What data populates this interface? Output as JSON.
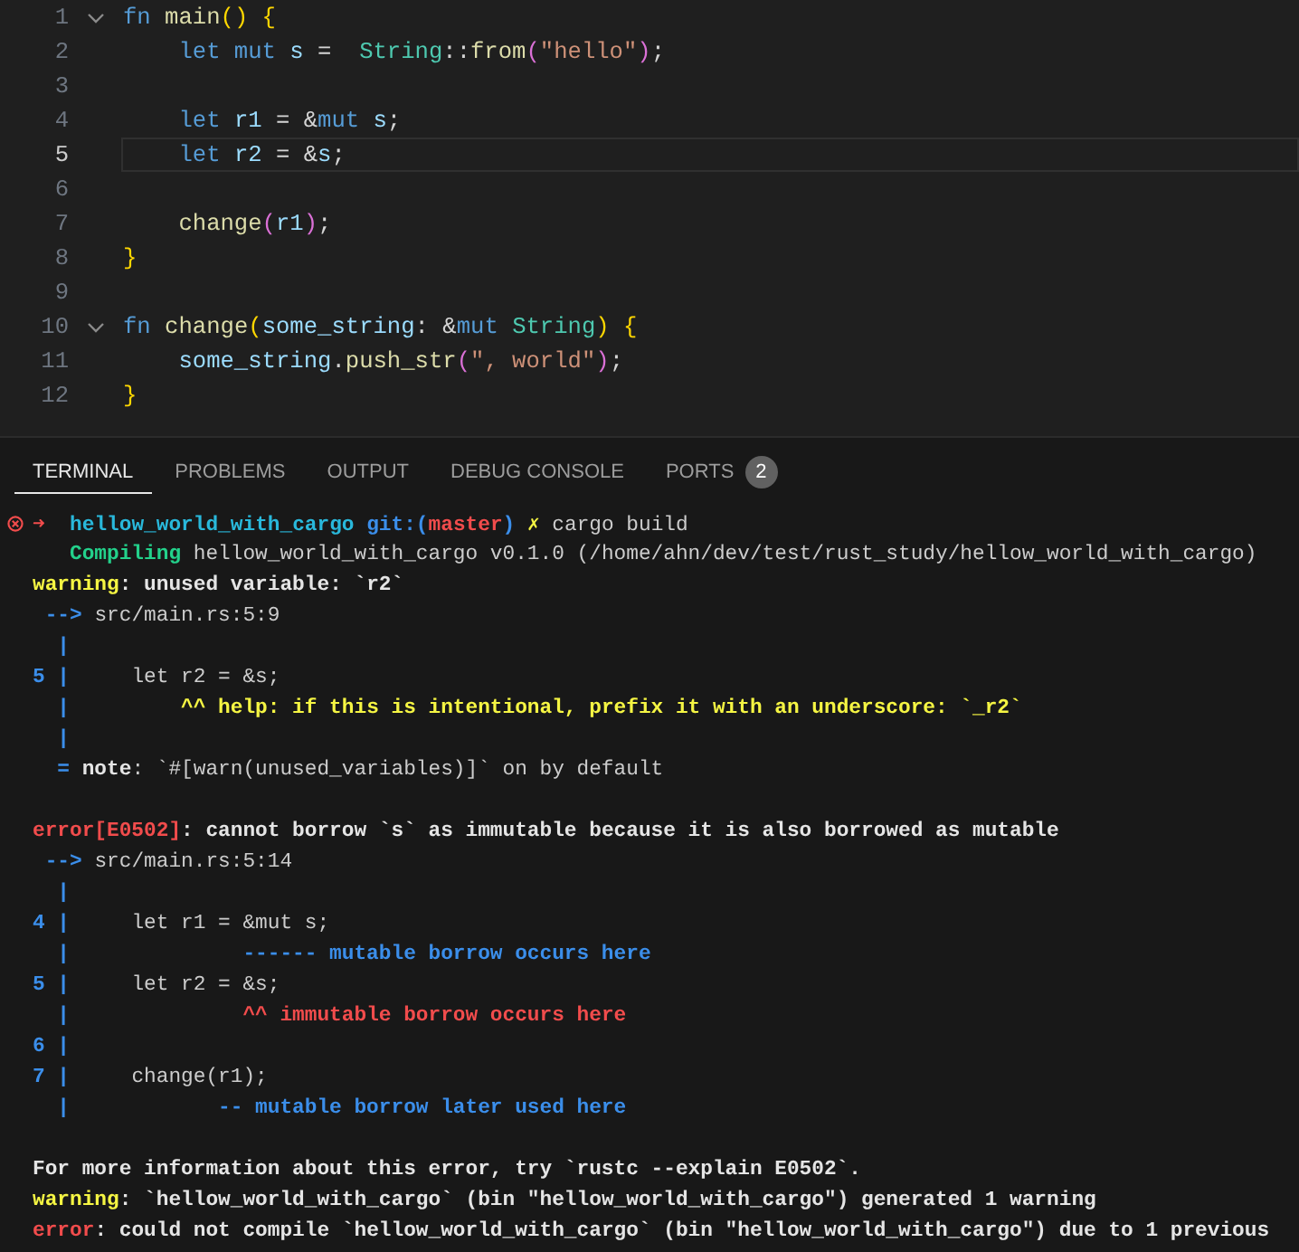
{
  "editor": {
    "lines": [
      {
        "number": "1",
        "current": false,
        "expanded": true,
        "segments": [
          {
            "kind": "kw",
            "text": "fn "
          },
          {
            "kind": "fn",
            "text": "main"
          },
          {
            "kind": "b1",
            "text": "() {"
          }
        ]
      },
      {
        "number": "2",
        "current": false,
        "segments": [
          {
            "kind": "kw",
            "text": "    let mut "
          },
          {
            "kind": "var",
            "text": "s"
          },
          {
            "kind": "plain",
            "text": " =  "
          },
          {
            "kind": "type",
            "text": "String"
          },
          {
            "kind": "plain",
            "text": "::"
          },
          {
            "kind": "fn",
            "text": "from"
          },
          {
            "kind": "b2",
            "text": "("
          },
          {
            "kind": "str",
            "text": "\"hello\""
          },
          {
            "kind": "b2",
            "text": ")"
          },
          {
            "kind": "plain",
            "text": ";"
          }
        ]
      },
      {
        "number": "3",
        "current": false
      },
      {
        "number": "4",
        "current": false,
        "segments": [
          {
            "kind": "kw",
            "text": "    let "
          },
          {
            "kind": "var",
            "text": "r1"
          },
          {
            "kind": "plain",
            "text": " = &"
          },
          {
            "kind": "kw",
            "text": "mut "
          },
          {
            "kind": "var",
            "text": "s"
          },
          {
            "kind": "plain",
            "text": ";"
          }
        ]
      },
      {
        "number": "5",
        "current": true,
        "segments": [
          {
            "kind": "kw",
            "text": "    let "
          },
          {
            "kind": "var",
            "text": "r2"
          },
          {
            "kind": "plain",
            "text": " = &"
          },
          {
            "kind": "var",
            "text": "s"
          },
          {
            "kind": "plain",
            "text": ";"
          }
        ]
      },
      {
        "number": "6",
        "current": false
      },
      {
        "number": "7",
        "current": false,
        "segments": [
          {
            "kind": "fn",
            "text": "    change"
          },
          {
            "kind": "b2",
            "text": "("
          },
          {
            "kind": "var",
            "text": "r1"
          },
          {
            "kind": "b2",
            "text": ")"
          },
          {
            "kind": "plain",
            "text": ";"
          }
        ]
      },
      {
        "number": "8",
        "current": false,
        "segments": [
          {
            "kind": "b1",
            "text": "}"
          }
        ]
      },
      {
        "number": "9",
        "current": false
      },
      {
        "number": "10",
        "current": false,
        "expanded": true,
        "segments": [
          {
            "kind": "kw",
            "text": "fn "
          },
          {
            "kind": "fn",
            "text": "change"
          },
          {
            "kind": "b1",
            "text": "("
          },
          {
            "kind": "var",
            "text": "some_string"
          },
          {
            "kind": "plain",
            "text": ": &"
          },
          {
            "kind": "kw",
            "text": "mut "
          },
          {
            "kind": "type",
            "text": "String"
          },
          {
            "kind": "b1",
            "text": ") {"
          }
        ]
      },
      {
        "number": "11",
        "current": false,
        "segments": [
          {
            "kind": "var",
            "text": "    some_string"
          },
          {
            "kind": "plain",
            "text": "."
          },
          {
            "kind": "fn",
            "text": "push_str"
          },
          {
            "kind": "b2",
            "text": "("
          },
          {
            "kind": "str",
            "text": "\", world\""
          },
          {
            "kind": "b2",
            "text": ")"
          },
          {
            "kind": "plain",
            "text": ";"
          }
        ]
      },
      {
        "number": "12",
        "current": false,
        "segments": [
          {
            "kind": "b1",
            "text": "}"
          }
        ]
      }
    ]
  },
  "panel": {
    "tabs": [
      {
        "label": "TERMINAL",
        "selected": true
      },
      {
        "label": "PROBLEMS",
        "selected": false
      },
      {
        "label": "OUTPUT",
        "selected": false
      },
      {
        "label": "DEBUG CONSOLE",
        "selected": false
      },
      {
        "label": "PORTS",
        "selected": false,
        "badge": "2"
      }
    ]
  },
  "terminal": {
    "lines": [
      {
        "kind": "prompt",
        "failed": true,
        "segments": [
          {
            "kind": "err",
            "text": "➜  "
          },
          {
            "kind": "cyan",
            "text": "hellow_world_with_cargo "
          },
          {
            "kind": "blue",
            "text": "git:("
          },
          {
            "kind": "err",
            "text": "master"
          },
          {
            "kind": "blue",
            "text": ") "
          },
          {
            "kind": "warn",
            "text": "✗"
          },
          {
            "kind": "plain",
            "text": " cargo build"
          }
        ]
      },
      {
        "kind": "output",
        "segments": [
          {
            "kind": "green",
            "text": "   Compiling"
          },
          {
            "kind": "plain",
            "text": " hellow_world_with_cargo v0.1.0 (/home/ahn/dev/test/rust_study/hellow_world_with_cargo)"
          }
        ]
      },
      {
        "kind": "output",
        "segments": [
          {
            "kind": "warn",
            "text": "warning"
          },
          {
            "kind": "bold",
            "text": ": unused variable: `r2`"
          }
        ]
      },
      {
        "kind": "output",
        "segments": [
          {
            "kind": "blue",
            "text": " --> "
          },
          {
            "kind": "plain",
            "text": "src/main.rs:5:9"
          }
        ]
      },
      {
        "kind": "output",
        "segments": [
          {
            "kind": "blue",
            "text": "  |"
          }
        ]
      },
      {
        "kind": "output",
        "segments": [
          {
            "kind": "blue",
            "text": "5 |"
          },
          {
            "kind": "plain",
            "text": "     let r2 = &s;"
          }
        ]
      },
      {
        "kind": "output",
        "segments": [
          {
            "kind": "blue",
            "text": "  |"
          },
          {
            "kind": "warn",
            "text": "         ^^ help: if this is intentional, prefix it with an underscore: `_r2`"
          }
        ]
      },
      {
        "kind": "output",
        "segments": [
          {
            "kind": "blue",
            "text": "  |"
          }
        ]
      },
      {
        "kind": "output",
        "segments": [
          {
            "kind": "blue",
            "text": "  = "
          },
          {
            "kind": "bold",
            "text": "note"
          },
          {
            "kind": "plain",
            "text": ": `#[warn(unused_variables)]` on by default"
          }
        ]
      },
      {
        "kind": "output"
      },
      {
        "kind": "output",
        "segments": [
          {
            "kind": "err",
            "text": "error[E0502]"
          },
          {
            "kind": "bold",
            "text": ": cannot borrow `s` as immutable because it is also borrowed as mutable"
          }
        ]
      },
      {
        "kind": "output",
        "segments": [
          {
            "kind": "blue",
            "text": " --> "
          },
          {
            "kind": "plain",
            "text": "src/main.rs:5:14"
          }
        ]
      },
      {
        "kind": "output",
        "segments": [
          {
            "kind": "blue",
            "text": "  |"
          }
        ]
      },
      {
        "kind": "output",
        "segments": [
          {
            "kind": "blue",
            "text": "4 |"
          },
          {
            "kind": "plain",
            "text": "     let r1 = &mut s;"
          }
        ]
      },
      {
        "kind": "output",
        "segments": [
          {
            "kind": "blue",
            "text": "  |              ------ mutable borrow occurs here"
          }
        ]
      },
      {
        "kind": "output",
        "segments": [
          {
            "kind": "blue",
            "text": "5 |"
          },
          {
            "kind": "plain",
            "text": "     let r2 = &s;"
          }
        ]
      },
      {
        "kind": "output",
        "segments": [
          {
            "kind": "blue",
            "text": "  |"
          },
          {
            "kind": "err",
            "text": "              ^^ immutable borrow occurs here"
          }
        ]
      },
      {
        "kind": "output",
        "segments": [
          {
            "kind": "blue",
            "text": "6 |"
          }
        ]
      },
      {
        "kind": "output",
        "segments": [
          {
            "kind": "blue",
            "text": "7 |"
          },
          {
            "kind": "plain",
            "text": "     change(r1);"
          }
        ]
      },
      {
        "kind": "output",
        "segments": [
          {
            "kind": "blue",
            "text": "  |            -- mutable borrow later used here"
          }
        ]
      },
      {
        "kind": "output"
      },
      {
        "kind": "output",
        "segments": [
          {
            "kind": "bold",
            "text": "For more information about this error, try `rustc --explain E0502`."
          }
        ]
      },
      {
        "kind": "output",
        "segments": [
          {
            "kind": "warn",
            "text": "warning"
          },
          {
            "kind": "bold",
            "text": ": `hellow_world_with_cargo` (bin \"hellow_world_with_cargo\") generated 1 warning"
          }
        ]
      },
      {
        "kind": "output",
        "segments": [
          {
            "kind": "err",
            "text": "error"
          },
          {
            "kind": "bold",
            "text": ": could not compile `hellow_world_with_cargo` (bin \"hellow_world_with_cargo\") due to 1 previous"
          }
        ]
      }
    ]
  }
}
